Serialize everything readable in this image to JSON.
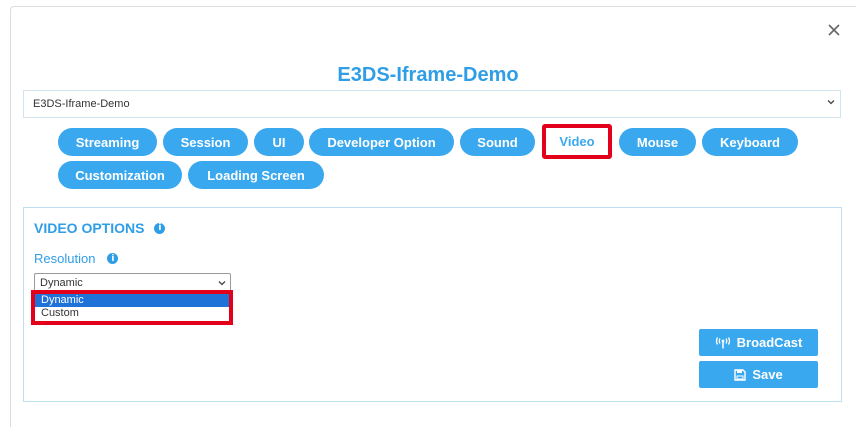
{
  "modal": {
    "title": "E3DS-Iframe-Demo",
    "close_icon": "close-icon",
    "app_select": {
      "value": "E3DS-Iframe-Demo"
    }
  },
  "tabs": [
    {
      "label": "Streaming"
    },
    {
      "label": "Session"
    },
    {
      "label": "UI"
    },
    {
      "label": "Developer Option"
    },
    {
      "label": "Sound"
    },
    {
      "label": "Video",
      "active": true
    },
    {
      "label": "Mouse"
    },
    {
      "label": "Keyboard"
    },
    {
      "label": "Customization"
    },
    {
      "label": "Loading Screen"
    }
  ],
  "video_options": {
    "title": "VIDEO OPTIONS",
    "resolution_label": "Resolution",
    "resolution_value": "Dynamic",
    "options": [
      "Dynamic",
      "Custom"
    ]
  },
  "buttons": {
    "broadcast": "BroadCast",
    "save": "Save"
  },
  "colors": {
    "accent": "#3aa8ef",
    "title": "#2f9ee6",
    "highlight": "#e3001b",
    "selected_option": "#1e72d8"
  }
}
